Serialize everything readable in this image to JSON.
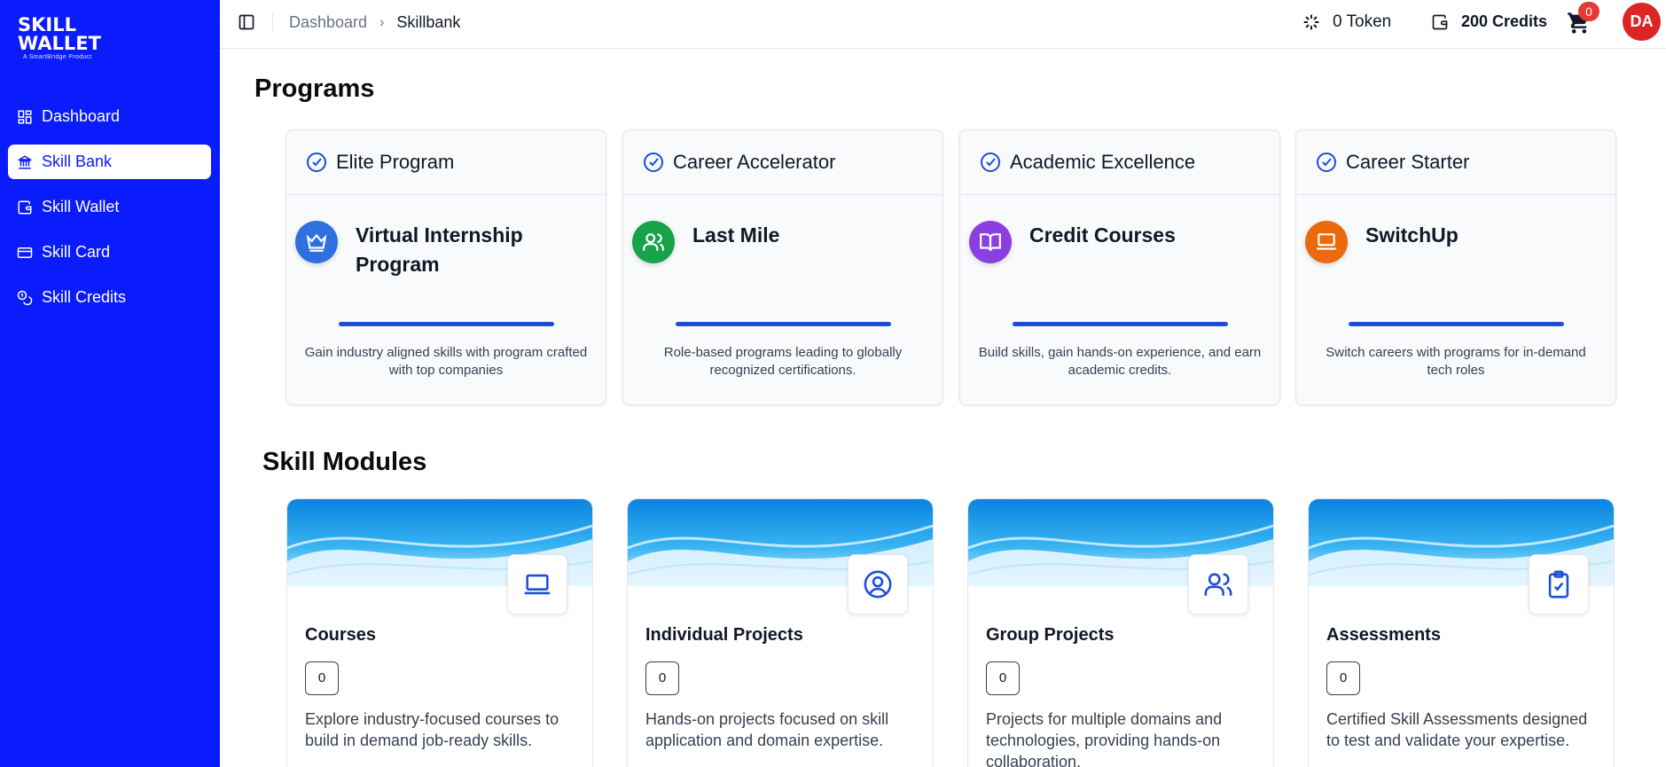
{
  "brand": {
    "line1": "SKILL",
    "line2": "WALLET",
    "tagline": "A SmartBridge Product"
  },
  "sidebar": {
    "items": [
      {
        "label": "Dashboard",
        "icon": "dashboard-grid-icon",
        "active": false
      },
      {
        "label": "Skill Bank",
        "icon": "bank-icon",
        "active": true
      },
      {
        "label": "Skill Wallet",
        "icon": "wallet-icon",
        "active": false
      },
      {
        "label": "Skill Card",
        "icon": "card-icon",
        "active": false
      },
      {
        "label": "Skill Credits",
        "icon": "coins-icon",
        "active": false
      }
    ]
  },
  "header": {
    "breadcrumb": [
      "Dashboard",
      "Skillbank"
    ],
    "token": "0 Token",
    "credits": "200 Credits",
    "cart_count": "0",
    "avatar": "DA"
  },
  "programs": {
    "title": "Programs",
    "items": [
      {
        "header": "Elite Program",
        "title": "Virtual Internship Program",
        "desc": "Gain industry aligned skills with program crafted with top companies",
        "icon": "crown-icon",
        "color": "#2f6fde"
      },
      {
        "header": "Career Accelerator",
        "title": "Last Mile",
        "desc": "Role-based programs leading to globally recognized certifications.",
        "icon": "users-icon",
        "color": "#16a34a"
      },
      {
        "header": "Academic Excellence",
        "title": "Credit Courses",
        "desc": "Build skills, gain hands-on experience, and earn academic credits.",
        "icon": "book-open-icon",
        "color": "#8b3fe0"
      },
      {
        "header": "Career Starter",
        "title": "SwitchUp",
        "desc": "Switch careers with programs for in-demand tech roles",
        "icon": "laptop-icon",
        "color": "#ea6a0c"
      }
    ]
  },
  "modules": {
    "title": "Skill Modules",
    "items": [
      {
        "title": "Courses",
        "count": "0",
        "desc": "Explore industry-focused courses to build in demand job-ready skills.",
        "icon": "laptop-icon"
      },
      {
        "title": "Individual Projects",
        "count": "0",
        "desc": "Hands-on projects focused on skill application and domain expertise.",
        "icon": "user-circle-icon"
      },
      {
        "title": "Group Projects",
        "count": "0",
        "desc": "Projects for multiple domains and technologies, providing hands-on collaboration.",
        "icon": "users-icon"
      },
      {
        "title": "Assessments",
        "count": "0",
        "desc": "Certified Skill Assessments designed to test and validate your expertise.",
        "icon": "clipboard-check-icon"
      }
    ]
  },
  "colors": {
    "sidebar": "#0a1cfb",
    "accent": "#1d4ed8",
    "badge": "#e53935",
    "avatar": "#dc2626"
  }
}
